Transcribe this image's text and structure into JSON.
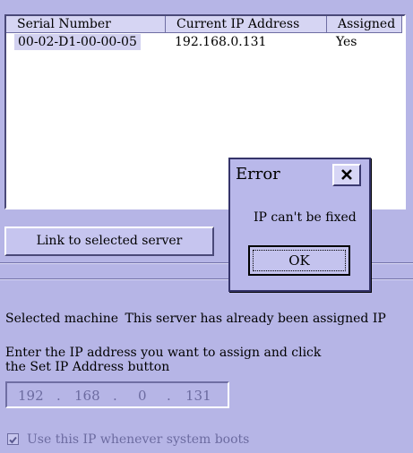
{
  "table": {
    "columns": [
      "Serial Number",
      "Current IP Address",
      "Assigned"
    ],
    "rows": [
      {
        "serial": "00-02-D1-00-00-05",
        "ip": "192.168.0.131",
        "assigned": "Yes"
      }
    ]
  },
  "link_button": "Link to selected server",
  "dialog": {
    "title": "Error",
    "message": "IP can't be fixed",
    "ok": "OK",
    "close_glyph": "×",
    "close_icon": "close-icon"
  },
  "selected_machine": {
    "label": "Selected machine",
    "status": "This server has already been assigned IP"
  },
  "instructions": {
    "line1": "Enter the IP address you want to assign and click",
    "line2": "the Set IP Address button"
  },
  "ip_field": {
    "octets": [
      "192",
      "168",
      "0",
      "131"
    ],
    "separator": "."
  },
  "checkbox": {
    "label": "Use this IP whenever system boots",
    "checked": true
  },
  "colors": {
    "background": "#b6b5e6",
    "selection": "#d2d1f0",
    "disabled_text": "#6c6ba0"
  }
}
